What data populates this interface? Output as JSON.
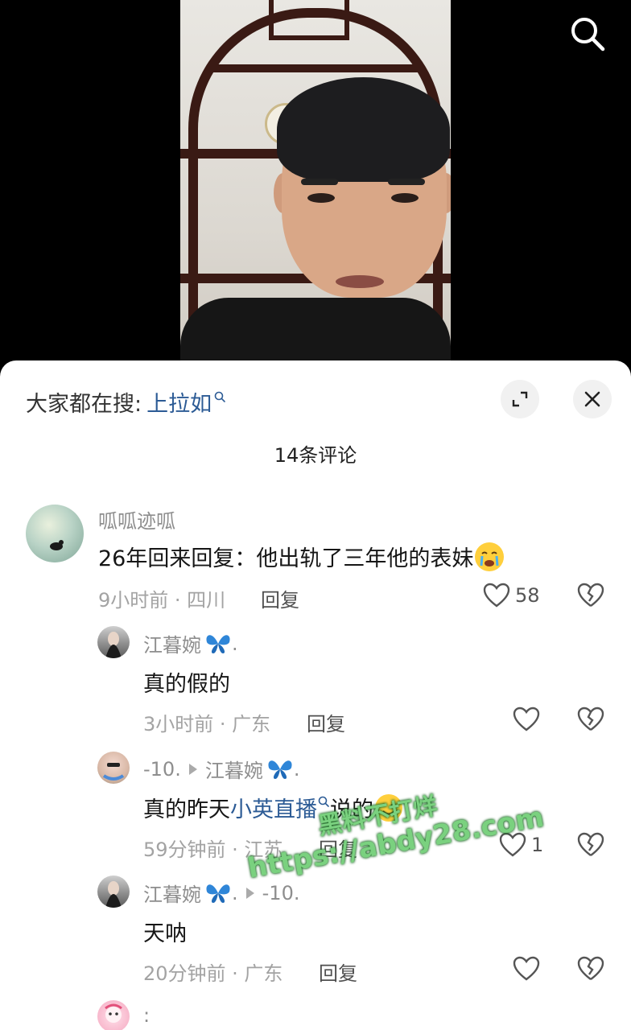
{
  "colors": {
    "link": "#2c5b95",
    "sheet_bg": "#ffffff",
    "watermark": "#7ad17f"
  },
  "header": {
    "trending_label": "大家都在搜:",
    "trending_term": "上拉如",
    "expand_icon": "expand-icon",
    "close_icon": "close-icon"
  },
  "comment_count_title": "14条评论",
  "comments": [
    {
      "user": "呱呱迹呱",
      "text": "26年回来回复：他出轨了三年他的表妹",
      "emoji": "crying-emoji",
      "meta": "9小时前 · 四川",
      "reply_label": "回复",
      "likes": "58"
    },
    {
      "user": "江暮婉",
      "user_suffix": ".",
      "text": "真的假的",
      "meta": "3小时前 · 广东",
      "reply_label": "回复",
      "likes": ""
    },
    {
      "user": "-10.",
      "reply_to": "江暮婉",
      "reply_to_suffix": ".",
      "text_before": "真的昨天",
      "text_link": "小英直播",
      "text_after": "说的",
      "meta": "59分钟前 · 江苏",
      "reply_label": "回复",
      "likes": "1"
    },
    {
      "user": "江暮婉",
      "user_suffix": ".",
      "reply_to": "-10.",
      "text": "天呐",
      "meta": "20分钟前 · 广东",
      "reply_label": "回复",
      "likes": ""
    },
    {
      "user": ":"
    }
  ],
  "watermark": {
    "line1": "黑料不打烊",
    "line2": "https://abdy28.com"
  }
}
